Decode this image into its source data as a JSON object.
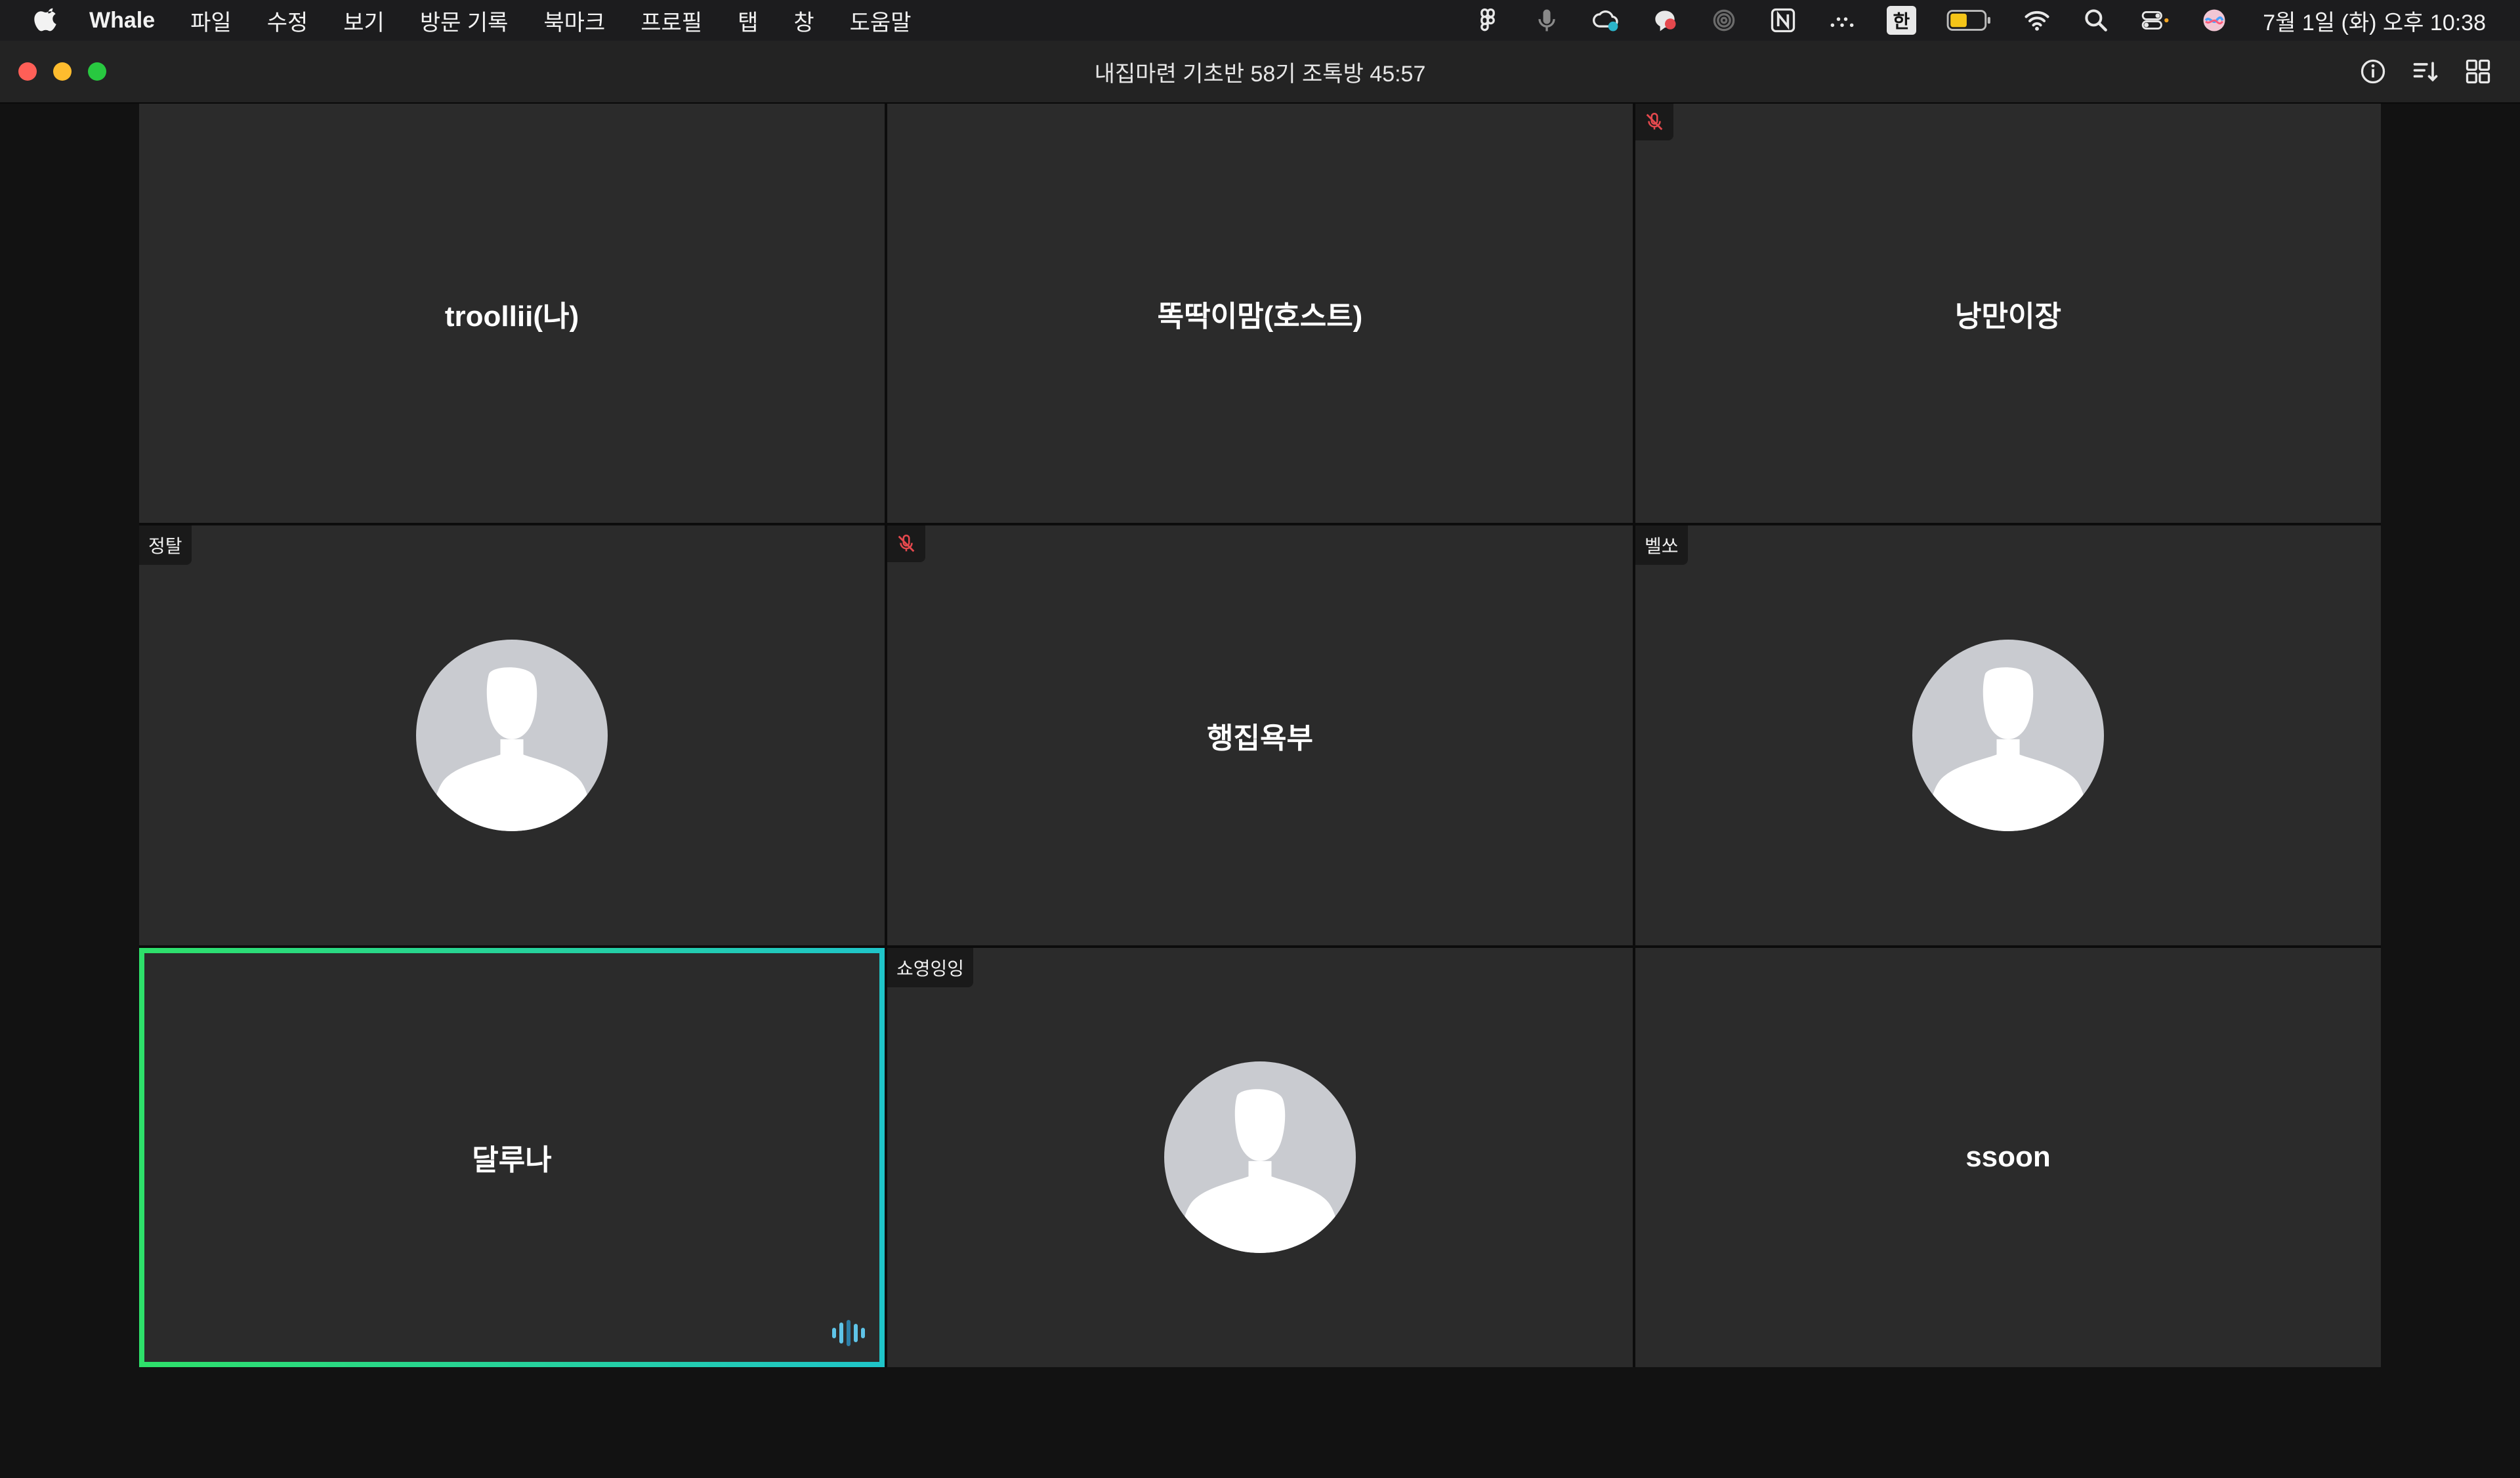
{
  "menubar": {
    "app_name": "Whale",
    "items": [
      "파일",
      "수정",
      "보기",
      "방문 기록",
      "북마크",
      "프로필",
      "탭",
      "창",
      "도움말"
    ],
    "ime_label": "한",
    "clock": "7월 1일 (화) 오후 10:38",
    "status_icons": [
      "figma-icon",
      "microphone-icon",
      "creative-cloud-icon",
      "chat-icon",
      "focus-icon",
      "notion-icon",
      "dots-icon",
      "input-method-icon",
      "battery-icon",
      "wifi-icon",
      "search-icon",
      "control-center-icon",
      "siri-icon"
    ]
  },
  "window": {
    "title": "내집마련 기초반 58기 조톡방 45:57",
    "tools": [
      "info-icon",
      "sort-icon",
      "gallery-view-icon"
    ]
  },
  "participants": [
    {
      "name": "troollii(나)",
      "display": "name",
      "tag": "",
      "muted": false,
      "speaking": false
    },
    {
      "name": "똑딱이맘(호스트)",
      "display": "name",
      "tag": "",
      "muted": false,
      "speaking": false
    },
    {
      "name": "낭만이장",
      "display": "name",
      "tag": "",
      "muted": true,
      "speaking": false
    },
    {
      "name": "정탈",
      "display": "avatar",
      "tag": "정탈",
      "muted": false,
      "speaking": false
    },
    {
      "name": "행집욕부",
      "display": "name",
      "tag": "",
      "muted": true,
      "speaking": false
    },
    {
      "name": "벨쏘",
      "display": "avatar",
      "tag": "벨쏘",
      "muted": false,
      "speaking": false
    },
    {
      "name": "달루나",
      "display": "name",
      "tag": "",
      "muted": false,
      "speaking": true
    },
    {
      "name": "쇼영잉잉",
      "display": "avatar",
      "tag": "쇼영잉잉",
      "muted": false,
      "speaking": false
    },
    {
      "name": "ssoon",
      "display": "name",
      "tag": "",
      "muted": false,
      "speaking": false
    }
  ],
  "colors": {
    "tile_bg": "#2b2b2b",
    "speaking_border_start": "#2ee06a",
    "speaking_border_end": "#1fc5c9",
    "mute_red": "#e5484d",
    "speaker_indicator": "#5fc4e8"
  }
}
